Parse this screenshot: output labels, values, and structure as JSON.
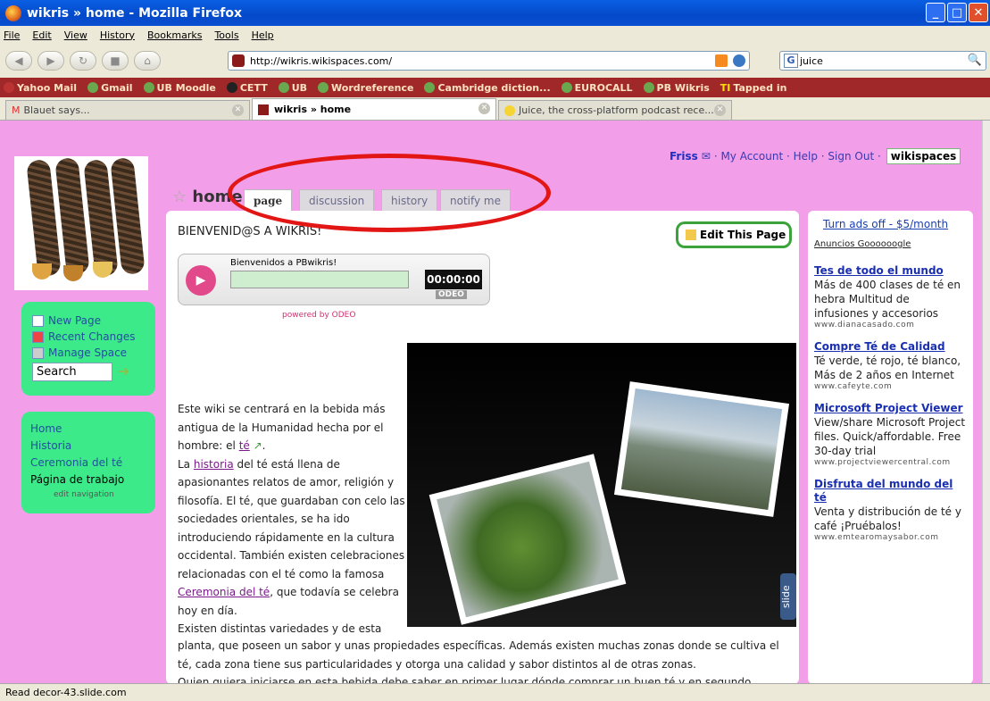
{
  "window": {
    "title": "wikris » home - Mozilla Firefox"
  },
  "menu": [
    "File",
    "Edit",
    "View",
    "History",
    "Bookmarks",
    "Tools",
    "Help"
  ],
  "url": "http://wikris.wikispaces.com/",
  "search": {
    "value": "juice"
  },
  "bookmarks": [
    "Yahoo Mail",
    "Gmail",
    "UB Moodle",
    "CETT",
    "UB",
    "Wordreference",
    "Cambridge diction...",
    "EUROCALL",
    "PB Wikris",
    "Tapped in"
  ],
  "tabs": [
    {
      "label": "Blauet says..."
    },
    {
      "label": "wikris » home"
    },
    {
      "label": "Juice, the cross-platform podcast rece..."
    }
  ],
  "status": "Read decor-43.slide.com",
  "top_links": {
    "user": "Friss",
    "my_account": "· My Account · Help · Sign Out ·",
    "brand": "wikispaces"
  },
  "page": {
    "title": "home",
    "tabs": [
      "page",
      "discussion",
      "history",
      "notify me"
    ],
    "welcome": "BIENVENID@S A WIKRIS!",
    "edit_button": "Edit This Page",
    "player": {
      "title": "Bienvenidos a PBwikris!",
      "time": "00:00:00",
      "brand": "ODEO",
      "powered": "powered by ODEO"
    },
    "slide_tag": "slide",
    "para1": "Este wiki se centrará en la bebida más antigua de la Humanidad hecha por el hombre: el ",
    "link_te": "té",
    "para2a": "La ",
    "link_historia": "historia",
    "para2b": " del té está llena de apasionantes relatos de amor, religión y filosofía. El té, que guardaban con celo las sociedades orientales, se ha ido introduciendo rápidamente en la cultura occidental. También existen celebraciones relacionadas con el té como la famosa ",
    "link_ceremonia": "Ceremonia del té",
    "para2c": ", que todavía se celebra hoy en día.",
    "para3a": "Existen distintas variedades y de esta",
    "para3b": "planta, que poseen un sabor y unas propiedades específicas. Además existen muchas zonas donde se cultiva el té, cada zona tiene sus particularidades y otorga una calidad y sabor distintos al de otras zonas.",
    "para3c": "Quien quiera iniciarse en esta bebida debe saber en primer lugar dónde comprar un buen té y en segundo"
  },
  "sidebar": {
    "tools": [
      "New Page",
      "Recent Changes",
      "Manage Space"
    ],
    "search_placeholder": "Search",
    "nav": [
      "Home",
      "Historia",
      "Ceremonia del té",
      "Página de trabajo"
    ],
    "edit_nav": "edit navigation"
  },
  "ads": {
    "turn_off": "Turn ads off - $5/month",
    "google": "Anuncios Goooooogle",
    "items": [
      {
        "title": "Tes de todo el mundo",
        "body": "Más de 400 clases de té en hebra Multitud de infusiones y accesorios",
        "url": "www.dianacasado.com"
      },
      {
        "title": "Compre Té de Calidad",
        "body": "Té verde, té rojo, té blanco, Más de 2 años en Internet",
        "url": "www.cafeyte.com"
      },
      {
        "title": "Microsoft Project Viewer",
        "body": "View/share Microsoft Project files. Quick/affordable. Free 30-day trial",
        "url": "www.projectviewercentral.com"
      },
      {
        "title": "Disfruta del mundo del té",
        "body": "Venta y distribución de té y café ¡Pruébalos!",
        "url": "www.emtearomaysabor.com"
      }
    ]
  }
}
